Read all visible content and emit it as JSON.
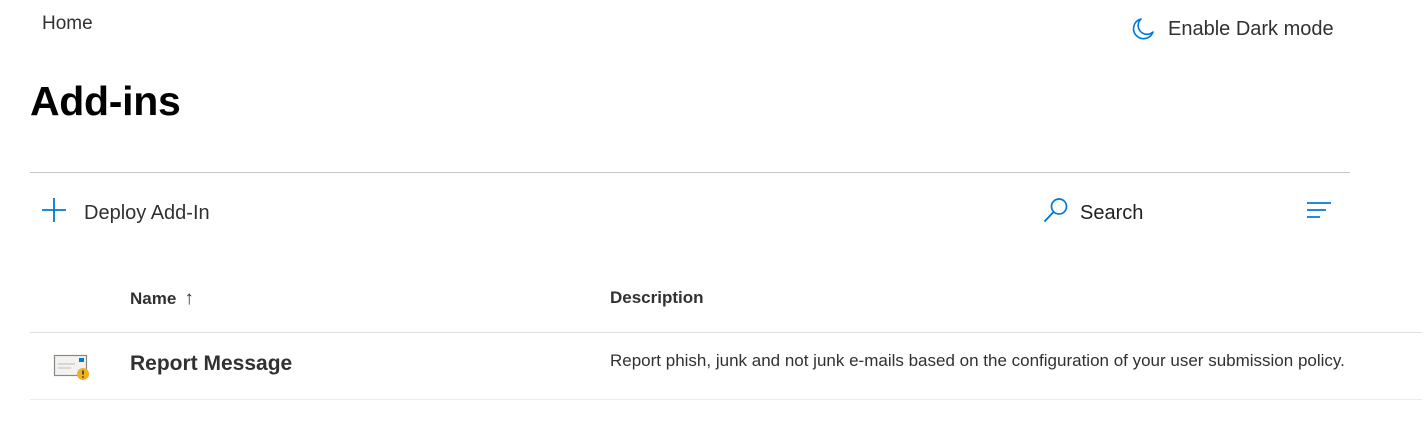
{
  "breadcrumb": {
    "home_label": "Home"
  },
  "header": {
    "dark_mode_label": "Enable Dark mode"
  },
  "page": {
    "title": "Add-ins"
  },
  "toolbar": {
    "deploy_label": "Deploy Add-In",
    "search_label": "Search",
    "accent_color": "#0078d4"
  },
  "table": {
    "columns": {
      "name": "Name",
      "name_sort_indicator": "↑",
      "description": "Description"
    },
    "rows": [
      {
        "icon": "report-message-icon",
        "name": "Report Message",
        "description": "Report phish, junk and not junk e-mails based on the configuration of your user submission policy."
      }
    ]
  }
}
